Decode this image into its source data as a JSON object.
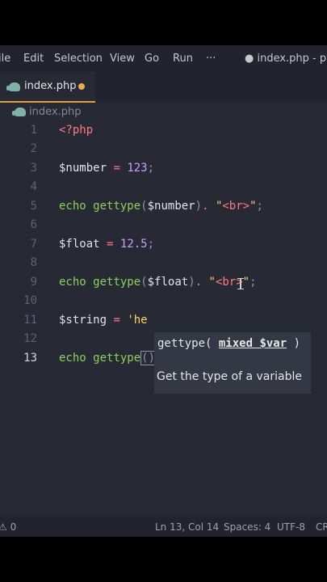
{
  "menu": {
    "items": [
      "ile",
      "Edit",
      "Selection",
      "View",
      "Go",
      "Run",
      "···"
    ],
    "window_title": "● index.php - php -"
  },
  "tab": {
    "label": "index.php"
  },
  "breadcrumb": {
    "file": "index.php"
  },
  "editor": {
    "line_numbers": [
      "1",
      "2",
      "3",
      "4",
      "5",
      "6",
      "7",
      "8",
      "9",
      "10",
      "11",
      "12",
      "13"
    ],
    "active_line": "13"
  },
  "tooltip": {
    "fn": "gettype(",
    "param": "mixed $var",
    "close": " )",
    "description": "Get the type of a variable"
  },
  "status": {
    "problems": "⚠ 0",
    "position": "Ln 13, Col 14",
    "spaces": "Spaces: 4",
    "encoding": "UTF-8",
    "eol": "CR"
  }
}
